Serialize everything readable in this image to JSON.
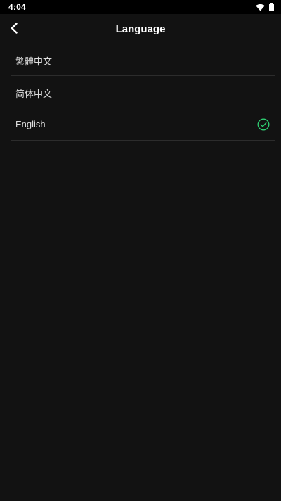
{
  "status_bar": {
    "time": "4:04",
    "icons": [
      "wifi-icon",
      "battery-icon"
    ]
  },
  "header": {
    "title": "Language",
    "back_icon": "chevron-left-icon"
  },
  "languages": [
    {
      "label": "繁體中文",
      "selected": false
    },
    {
      "label": "简体中文",
      "selected": false
    },
    {
      "label": "English",
      "selected": true
    }
  ],
  "colors": {
    "background": "#121212",
    "accent": "#2ecc71",
    "divider": "#2c2c2c"
  }
}
